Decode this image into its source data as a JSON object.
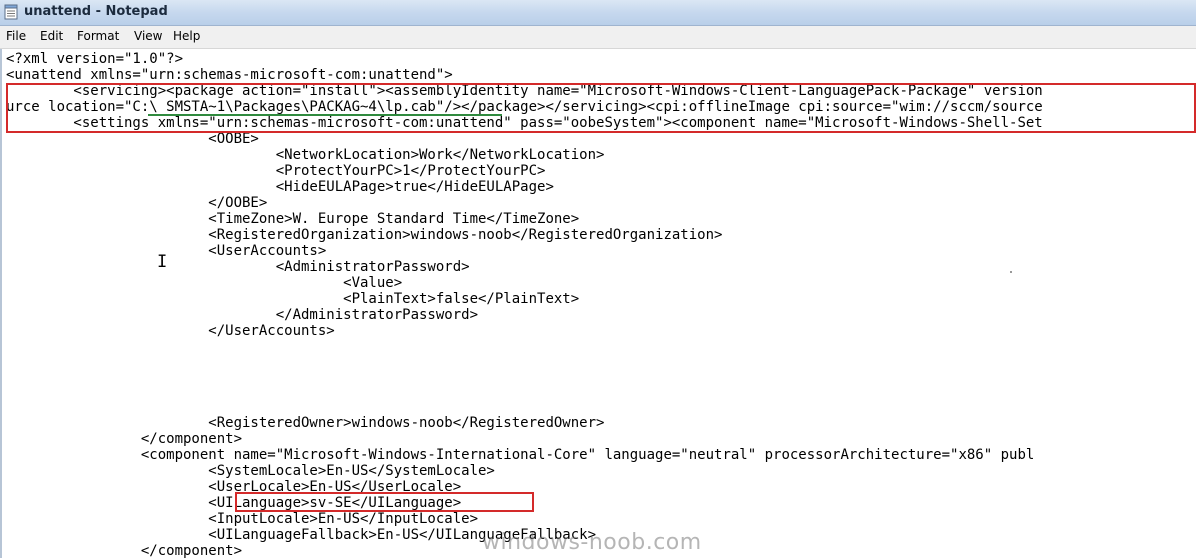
{
  "window": {
    "title": "unattend - Notepad"
  },
  "menu": [
    "File",
    "Edit",
    "Format",
    "View",
    "Help"
  ],
  "editor": {
    "lines": [
      "<?xml version=\"1.0\"?>",
      "<unattend xmlns=\"urn:schemas-microsoft-com:unattend\">",
      "        <servicing><package action=\"install\"><assemblyIdentity name=\"Microsoft-Windows-Client-LanguagePack-Package\" version",
      "urce location=\"C:\\_SMSTA~1\\Packages\\PACKAG~4\\lp.cab\"/></package></servicing><cpi:offlineImage cpi:source=\"wim://sccm/source",
      "        <settings xmlns=\"urn:schemas-microsoft-com:unattend\" pass=\"oobeSystem\"><component name=\"Microsoft-Windows-Shell-Set",
      "                        <OOBE>",
      "                                <NetworkLocation>Work</NetworkLocation>",
      "                                <ProtectYourPC>1</ProtectYourPC>",
      "                                <HideEULAPage>true</HideEULAPage>",
      "                        </OOBE>",
      "                        <TimeZone>W. Europe Standard Time</TimeZone>",
      "                        <RegisteredOrganization>windows-noob</RegisteredOrganization>",
      "                        <UserAccounts>",
      "                                <AdministratorPassword>",
      "                                        <Value>",
      "                                        <PlainText>false</PlainText>",
      "                                </AdministratorPassword>",
      "                        </UserAccounts>",
      "",
      "",
      "",
      "",
      "                        <RegisteredOwner>windows-noob</RegisteredOwner>",
      "                </component>",
      "                <component name=\"Microsoft-Windows-International-Core\" language=\"neutral\" processorArchitecture=\"x86\" publ",
      "                        <SystemLocale>En-US</SystemLocale>",
      "                        <UserLocale>En-US</UserLocale>",
      "                        <UILanguage>sv-SE</UILanguage>",
      "                        <InputLocale>En-US</InputLocale>",
      "                        <UILanguageFallback>En-US</UILanguageFallback>",
      "                </component>"
    ]
  },
  "watermark": "windows-noob.com",
  "colors": {
    "highlight_box": "#d42a2a",
    "underline": "#2f8a3e",
    "titlebar": "#c6d8ee"
  }
}
